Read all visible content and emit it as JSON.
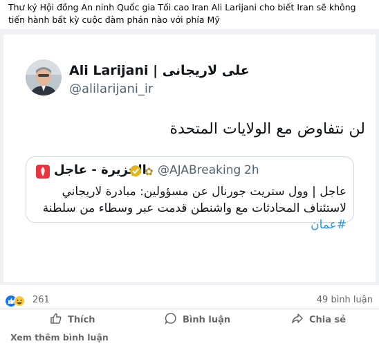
{
  "post": {
    "caption": "Thư ký Hội đồng An ninh Quốc gia Tối cao Iran Ali Larijani cho biết Iran sẽ không tiến hành bất kỳ cuộc đàm phán nào với phía Mỹ"
  },
  "tweet": {
    "display_name": "Ali Larijani | على لاريجانى",
    "handle": "@alilarijani_ir",
    "text": "لن نتفاوض مع الولايات المتحدة"
  },
  "quoted_tweet": {
    "display_name": "الجزيرة - عاجل",
    "handle": "@AJABreaking",
    "separator": "·",
    "time": "2h",
    "text": "عاجل | وول ستريت جورنال عن مسؤولين: مبادرة لاريجاني لاستئناف المحادثات مع واشنطن قدمت عبر وسطاء من سلطنة ",
    "hashtag": "#عمان"
  },
  "engagement": {
    "reaction_count": "261",
    "comment_count": "49 bình luận"
  },
  "actions": {
    "like_label": "Thích",
    "comment_label": "Bình luận",
    "share_label": "Chia sẻ"
  },
  "footer": {
    "see_more_comments": "Xem thêm bình luận"
  }
}
